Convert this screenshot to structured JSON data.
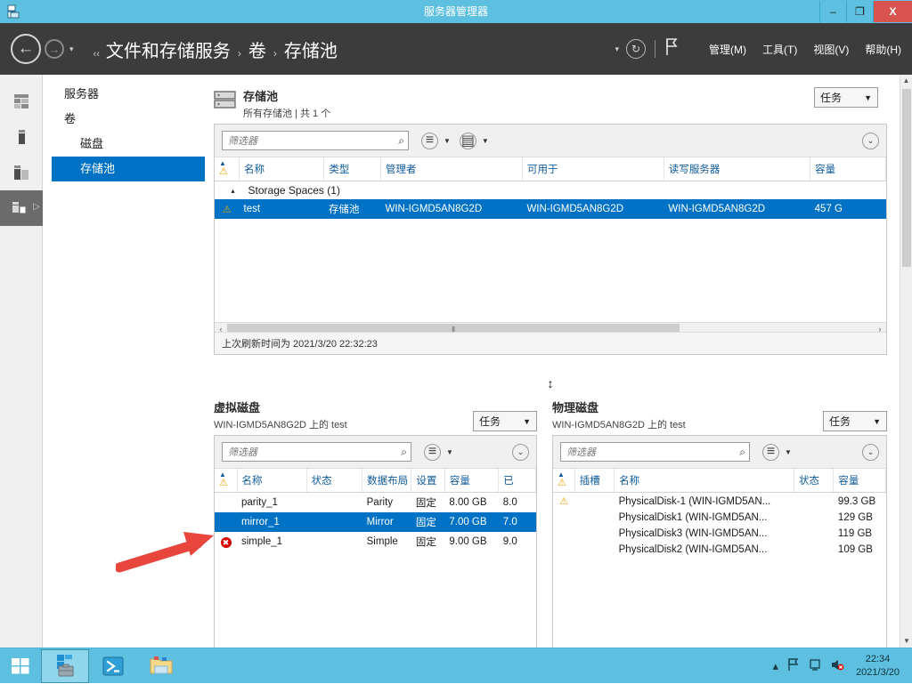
{
  "window": {
    "title": "服务器管理器",
    "app_icon": "server-manager-icon",
    "minimize_label": "–",
    "restore_label": "❐",
    "close_label": "X"
  },
  "command_bar": {
    "back_icon": "←",
    "forward_icon": "→",
    "dropdown_caret": "▾",
    "breadcrumb_lead": "‹‹",
    "breadcrumb": [
      {
        "label": "文件和存储服务"
      },
      {
        "label": "卷"
      },
      {
        "label": "存储池"
      }
    ],
    "separator": "›",
    "refresh_icon": "↻",
    "flag_icon": "⚑",
    "menus": [
      {
        "label": "管理(M)"
      },
      {
        "label": "工具(T)"
      },
      {
        "label": "视图(V)"
      },
      {
        "label": "帮助(H)"
      }
    ]
  },
  "rail": {
    "items": [
      {
        "icon": "dashboard-grid-icon",
        "active": false
      },
      {
        "icon": "volume-icon",
        "active": false
      },
      {
        "icon": "disks-icon",
        "active": false
      },
      {
        "icon": "storage-pools-icon",
        "active": true
      }
    ],
    "chevron": "▷"
  },
  "nav": {
    "items": [
      {
        "label": "服务器",
        "sub": false,
        "selected": false
      },
      {
        "label": "卷",
        "sub": false,
        "selected": false
      },
      {
        "label": "磁盘",
        "sub": true,
        "selected": false
      },
      {
        "label": "存储池",
        "sub": true,
        "selected": true
      }
    ]
  },
  "storage_pools": {
    "icon": "storage-pool-icon",
    "title": "存储池",
    "subtitle": "所有存储池 | 共 1 个",
    "tasks_label": "任务",
    "tasks_caret": "▼",
    "filter_placeholder": "筛选器",
    "search_icon": "⌕",
    "list_icon": "≡",
    "save_icon": "▤",
    "caret": "▼",
    "expander_icon": "⌄",
    "columns": [
      "名称",
      "类型",
      "管理者",
      "可用于",
      "读写服务器",
      "容量"
    ],
    "group_row": "Storage Spaces (1)",
    "group_caret": "▴",
    "rows": [
      {
        "status": "warning",
        "名称": "test",
        "类型": "存储池",
        "管理者": "WIN-IGMD5AN8G2D",
        "可用于": "WIN-IGMD5AN8G2D",
        "读写服务器": "WIN-IGMD5AN8G2D",
        "容量": "457 G",
        "selected": true
      }
    ],
    "scroll_left": "‹",
    "scroll_right": "›",
    "scroll_grip": "Ⅱ",
    "status_text": "上次刷新时间为 2021/3/20 22:32:23"
  },
  "splitter": {
    "handle_icon": "↕"
  },
  "virtual_disks": {
    "title": "虚拟磁盘",
    "subtitle": "WIN-IGMD5AN8G2D 上的 test",
    "tasks_label": "任务",
    "tasks_caret": "▼",
    "filter_placeholder": "筛选器",
    "search_icon": "⌕",
    "list_icon": "≡",
    "caret": "▼",
    "expander_icon": "⌄",
    "columns": [
      "名称",
      "状态",
      "数据布局",
      "设置",
      "容量",
      "已"
    ],
    "rows": [
      {
        "status": "none",
        "名称": "parity_1",
        "状态": "",
        "数据布局": "Parity",
        "设置": "固定",
        "容量": "8.00 GB",
        "已": "8.0",
        "selected": false
      },
      {
        "status": "none",
        "名称": "mirror_1",
        "状态": "",
        "数据布局": "Mirror",
        "设置": "固定",
        "容量": "7.00 GB",
        "已": "7.0",
        "selected": true
      },
      {
        "status": "error",
        "名称": "simple_1",
        "状态": "",
        "数据布局": "Simple",
        "设置": "固定",
        "容量": "9.00 GB",
        "已": "9.0",
        "selected": false
      }
    ]
  },
  "physical_disks": {
    "title": "物理磁盘",
    "subtitle": "WIN-IGMD5AN8G2D 上的 test",
    "tasks_label": "任务",
    "tasks_caret": "▼",
    "filter_placeholder": "筛选器",
    "search_icon": "⌕",
    "list_icon": "≡",
    "caret": "▼",
    "expander_icon": "⌄",
    "columns": [
      "插槽",
      "名称",
      "状态",
      "容量"
    ],
    "rows": [
      {
        "status": "warning",
        "插槽": "",
        "名称": "PhysicalDisk-1 (WIN-IGMD5AN...",
        "状态": "",
        "容量": "99.3 GB"
      },
      {
        "status": "none",
        "插槽": "",
        "名称": "PhysicalDisk1 (WIN-IGMD5AN...",
        "状态": "",
        "容量": "129 GB"
      },
      {
        "status": "none",
        "插槽": "",
        "名称": "PhysicalDisk3 (WIN-IGMD5AN...",
        "状态": "",
        "容量": "119 GB"
      },
      {
        "status": "none",
        "插槽": "",
        "名称": "PhysicalDisk2 (WIN-IGMD5AN...",
        "状态": "",
        "容量": "109 GB"
      }
    ]
  },
  "annotation": {
    "arrow_color": "#e8453c",
    "points_to": "mirror_1"
  },
  "taskbar": {
    "start_icon": "windows-logo-icon",
    "apps": [
      {
        "icon": "server-manager-icon",
        "active": true
      },
      {
        "icon": "powershell-icon",
        "active": false
      },
      {
        "icon": "file-explorer-icon",
        "active": false
      }
    ],
    "tray_expand": "▴",
    "tray_icons": [
      "flag-icon",
      "network-icon",
      "volume-muted-icon"
    ],
    "time": "22:34",
    "date": "2021/3/20"
  },
  "colors": {
    "accent": "#0072c6",
    "titlebar": "#5dc0e0",
    "cmdbar": "#3c3c3c",
    "close": "#d9534f",
    "warning": "#e8a200",
    "error": "#d60000",
    "arrow": "#e8453c"
  }
}
